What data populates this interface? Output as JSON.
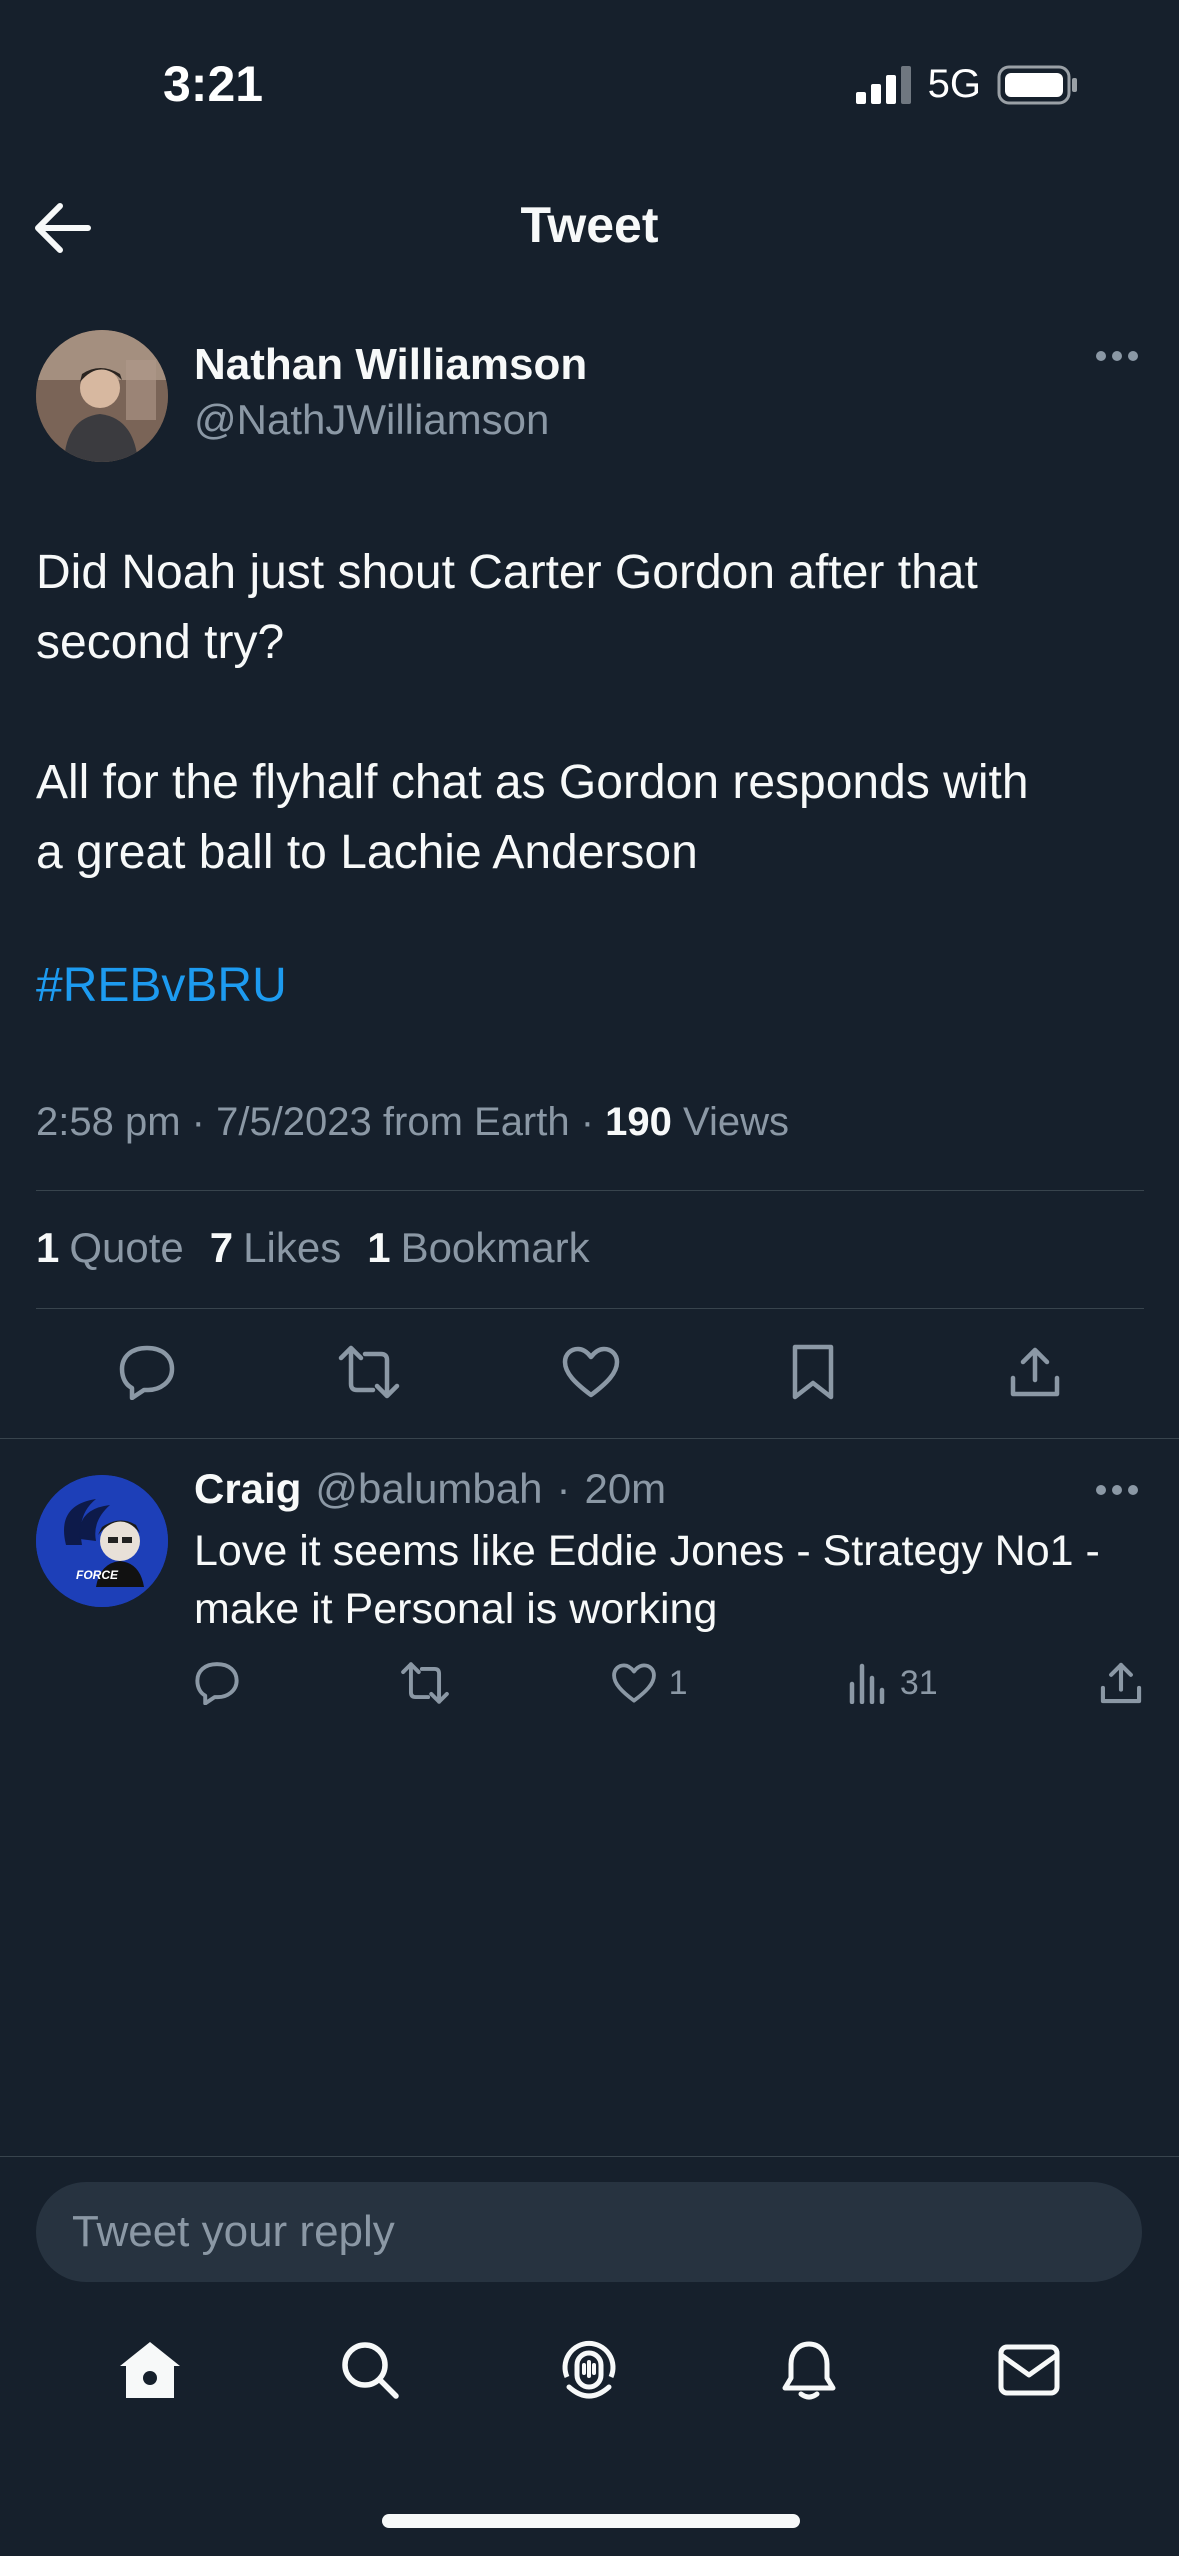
{
  "status_bar": {
    "time": "3:21",
    "network": "5G"
  },
  "header": {
    "title": "Tweet"
  },
  "tweet": {
    "author_name": "Nathan Williamson",
    "author_handle": "@NathJWilliamson",
    "body": "Did Noah just shout Carter Gordon after that\nsecond try?\n\nAll for the flyhalf chat as Gordon responds with\na great ball to Lachie Anderson",
    "hashtag": "#REBvBRU",
    "meta_prefix": "2:58 pm · 7/5/2023 from Earth · ",
    "views_count": "190",
    "views_label": "Views",
    "quotes_count": "1",
    "quotes_label": "Quote",
    "likes_count": "7",
    "likes_label": "Likes",
    "bookmarks_count": "1",
    "bookmarks_label": "Bookmark"
  },
  "reply": {
    "name": "Craig",
    "handle": "@balumbah",
    "dot": "·",
    "time": "20m",
    "text": "Love it seems like Eddie Jones - Strategy No1 - make it Personal is working",
    "likes": "1",
    "views": "31"
  },
  "compose": {
    "placeholder": "Tweet your reply"
  },
  "colors": {
    "background": "#16202c",
    "accent": "#1d9bf0",
    "muted": "#8b98a5"
  },
  "icons": [
    "back-arrow-icon",
    "more-icon",
    "reply-icon",
    "retweet-icon",
    "like-icon",
    "bookmark-icon",
    "share-icon",
    "views-icon",
    "home-icon",
    "search-icon",
    "spaces-icon",
    "notifications-icon",
    "messages-icon"
  ]
}
